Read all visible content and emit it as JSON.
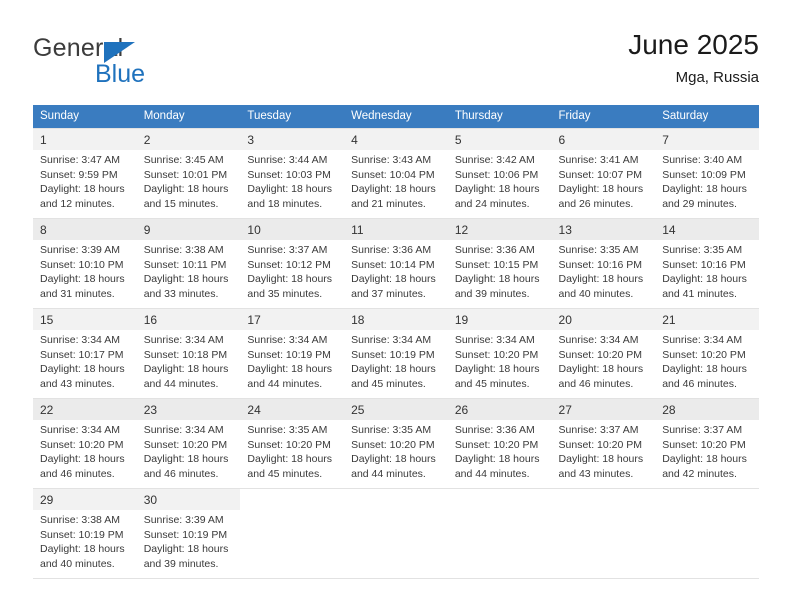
{
  "logo": {
    "word_one": "General",
    "word_two": "Blue",
    "triangle_color": "#1f72bd",
    "text_color": "#3c3c3c"
  },
  "header": {
    "title": "June 2025",
    "subtitle": "Mga, Russia"
  },
  "theme": {
    "header_bg": "#3a7cc0",
    "header_text": "#ffffff",
    "row_shade": "#f4f4f4",
    "grid_line": "#e2e2e2"
  },
  "calendar": {
    "weekday_headers": [
      "Sunday",
      "Monday",
      "Tuesday",
      "Wednesday",
      "Thursday",
      "Friday",
      "Saturday"
    ],
    "labels": {
      "sunrise": "Sunrise:",
      "sunset": "Sunset:",
      "daylight": "Daylight:"
    },
    "weeks": [
      [
        {
          "day": "1",
          "sunrise": "Sunrise: 3:47 AM",
          "sunset": "Sunset: 9:59 PM",
          "daylight_l1": "Daylight: 18 hours",
          "daylight_l2": "and 12 minutes."
        },
        {
          "day": "2",
          "sunrise": "Sunrise: 3:45 AM",
          "sunset": "Sunset: 10:01 PM",
          "daylight_l1": "Daylight: 18 hours",
          "daylight_l2": "and 15 minutes."
        },
        {
          "day": "3",
          "sunrise": "Sunrise: 3:44 AM",
          "sunset": "Sunset: 10:03 PM",
          "daylight_l1": "Daylight: 18 hours",
          "daylight_l2": "and 18 minutes."
        },
        {
          "day": "4",
          "sunrise": "Sunrise: 3:43 AM",
          "sunset": "Sunset: 10:04 PM",
          "daylight_l1": "Daylight: 18 hours",
          "daylight_l2": "and 21 minutes."
        },
        {
          "day": "5",
          "sunrise": "Sunrise: 3:42 AM",
          "sunset": "Sunset: 10:06 PM",
          "daylight_l1": "Daylight: 18 hours",
          "daylight_l2": "and 24 minutes."
        },
        {
          "day": "6",
          "sunrise": "Sunrise: 3:41 AM",
          "sunset": "Sunset: 10:07 PM",
          "daylight_l1": "Daylight: 18 hours",
          "daylight_l2": "and 26 minutes."
        },
        {
          "day": "7",
          "sunrise": "Sunrise: 3:40 AM",
          "sunset": "Sunset: 10:09 PM",
          "daylight_l1": "Daylight: 18 hours",
          "daylight_l2": "and 29 minutes."
        }
      ],
      [
        {
          "day": "8",
          "sunrise": "Sunrise: 3:39 AM",
          "sunset": "Sunset: 10:10 PM",
          "daylight_l1": "Daylight: 18 hours",
          "daylight_l2": "and 31 minutes."
        },
        {
          "day": "9",
          "sunrise": "Sunrise: 3:38 AM",
          "sunset": "Sunset: 10:11 PM",
          "daylight_l1": "Daylight: 18 hours",
          "daylight_l2": "and 33 minutes."
        },
        {
          "day": "10",
          "sunrise": "Sunrise: 3:37 AM",
          "sunset": "Sunset: 10:12 PM",
          "daylight_l1": "Daylight: 18 hours",
          "daylight_l2": "and 35 minutes."
        },
        {
          "day": "11",
          "sunrise": "Sunrise: 3:36 AM",
          "sunset": "Sunset: 10:14 PM",
          "daylight_l1": "Daylight: 18 hours",
          "daylight_l2": "and 37 minutes."
        },
        {
          "day": "12",
          "sunrise": "Sunrise: 3:36 AM",
          "sunset": "Sunset: 10:15 PM",
          "daylight_l1": "Daylight: 18 hours",
          "daylight_l2": "and 39 minutes."
        },
        {
          "day": "13",
          "sunrise": "Sunrise: 3:35 AM",
          "sunset": "Sunset: 10:16 PM",
          "daylight_l1": "Daylight: 18 hours",
          "daylight_l2": "and 40 minutes."
        },
        {
          "day": "14",
          "sunrise": "Sunrise: 3:35 AM",
          "sunset": "Sunset: 10:16 PM",
          "daylight_l1": "Daylight: 18 hours",
          "daylight_l2": "and 41 minutes."
        }
      ],
      [
        {
          "day": "15",
          "sunrise": "Sunrise: 3:34 AM",
          "sunset": "Sunset: 10:17 PM",
          "daylight_l1": "Daylight: 18 hours",
          "daylight_l2": "and 43 minutes."
        },
        {
          "day": "16",
          "sunrise": "Sunrise: 3:34 AM",
          "sunset": "Sunset: 10:18 PM",
          "daylight_l1": "Daylight: 18 hours",
          "daylight_l2": "and 44 minutes."
        },
        {
          "day": "17",
          "sunrise": "Sunrise: 3:34 AM",
          "sunset": "Sunset: 10:19 PM",
          "daylight_l1": "Daylight: 18 hours",
          "daylight_l2": "and 44 minutes."
        },
        {
          "day": "18",
          "sunrise": "Sunrise: 3:34 AM",
          "sunset": "Sunset: 10:19 PM",
          "daylight_l1": "Daylight: 18 hours",
          "daylight_l2": "and 45 minutes."
        },
        {
          "day": "19",
          "sunrise": "Sunrise: 3:34 AM",
          "sunset": "Sunset: 10:20 PM",
          "daylight_l1": "Daylight: 18 hours",
          "daylight_l2": "and 45 minutes."
        },
        {
          "day": "20",
          "sunrise": "Sunrise: 3:34 AM",
          "sunset": "Sunset: 10:20 PM",
          "daylight_l1": "Daylight: 18 hours",
          "daylight_l2": "and 46 minutes."
        },
        {
          "day": "21",
          "sunrise": "Sunrise: 3:34 AM",
          "sunset": "Sunset: 10:20 PM",
          "daylight_l1": "Daylight: 18 hours",
          "daylight_l2": "and 46 minutes."
        }
      ],
      [
        {
          "day": "22",
          "sunrise": "Sunrise: 3:34 AM",
          "sunset": "Sunset: 10:20 PM",
          "daylight_l1": "Daylight: 18 hours",
          "daylight_l2": "and 46 minutes."
        },
        {
          "day": "23",
          "sunrise": "Sunrise: 3:34 AM",
          "sunset": "Sunset: 10:20 PM",
          "daylight_l1": "Daylight: 18 hours",
          "daylight_l2": "and 46 minutes."
        },
        {
          "day": "24",
          "sunrise": "Sunrise: 3:35 AM",
          "sunset": "Sunset: 10:20 PM",
          "daylight_l1": "Daylight: 18 hours",
          "daylight_l2": "and 45 minutes."
        },
        {
          "day": "25",
          "sunrise": "Sunrise: 3:35 AM",
          "sunset": "Sunset: 10:20 PM",
          "daylight_l1": "Daylight: 18 hours",
          "daylight_l2": "and 44 minutes."
        },
        {
          "day": "26",
          "sunrise": "Sunrise: 3:36 AM",
          "sunset": "Sunset: 10:20 PM",
          "daylight_l1": "Daylight: 18 hours",
          "daylight_l2": "and 44 minutes."
        },
        {
          "day": "27",
          "sunrise": "Sunrise: 3:37 AM",
          "sunset": "Sunset: 10:20 PM",
          "daylight_l1": "Daylight: 18 hours",
          "daylight_l2": "and 43 minutes."
        },
        {
          "day": "28",
          "sunrise": "Sunrise: 3:37 AM",
          "sunset": "Sunset: 10:20 PM",
          "daylight_l1": "Daylight: 18 hours",
          "daylight_l2": "and 42 minutes."
        }
      ],
      [
        {
          "day": "29",
          "sunrise": "Sunrise: 3:38 AM",
          "sunset": "Sunset: 10:19 PM",
          "daylight_l1": "Daylight: 18 hours",
          "daylight_l2": "and 40 minutes."
        },
        {
          "day": "30",
          "sunrise": "Sunrise: 3:39 AM",
          "sunset": "Sunset: 10:19 PM",
          "daylight_l1": "Daylight: 18 hours",
          "daylight_l2": "and 39 minutes."
        },
        {
          "day": "",
          "sunrise": "",
          "sunset": "",
          "daylight_l1": "",
          "daylight_l2": ""
        },
        {
          "day": "",
          "sunrise": "",
          "sunset": "",
          "daylight_l1": "",
          "daylight_l2": ""
        },
        {
          "day": "",
          "sunrise": "",
          "sunset": "",
          "daylight_l1": "",
          "daylight_l2": ""
        },
        {
          "day": "",
          "sunrise": "",
          "sunset": "",
          "daylight_l1": "",
          "daylight_l2": ""
        },
        {
          "day": "",
          "sunrise": "",
          "sunset": "",
          "daylight_l1": "",
          "daylight_l2": ""
        }
      ]
    ]
  }
}
